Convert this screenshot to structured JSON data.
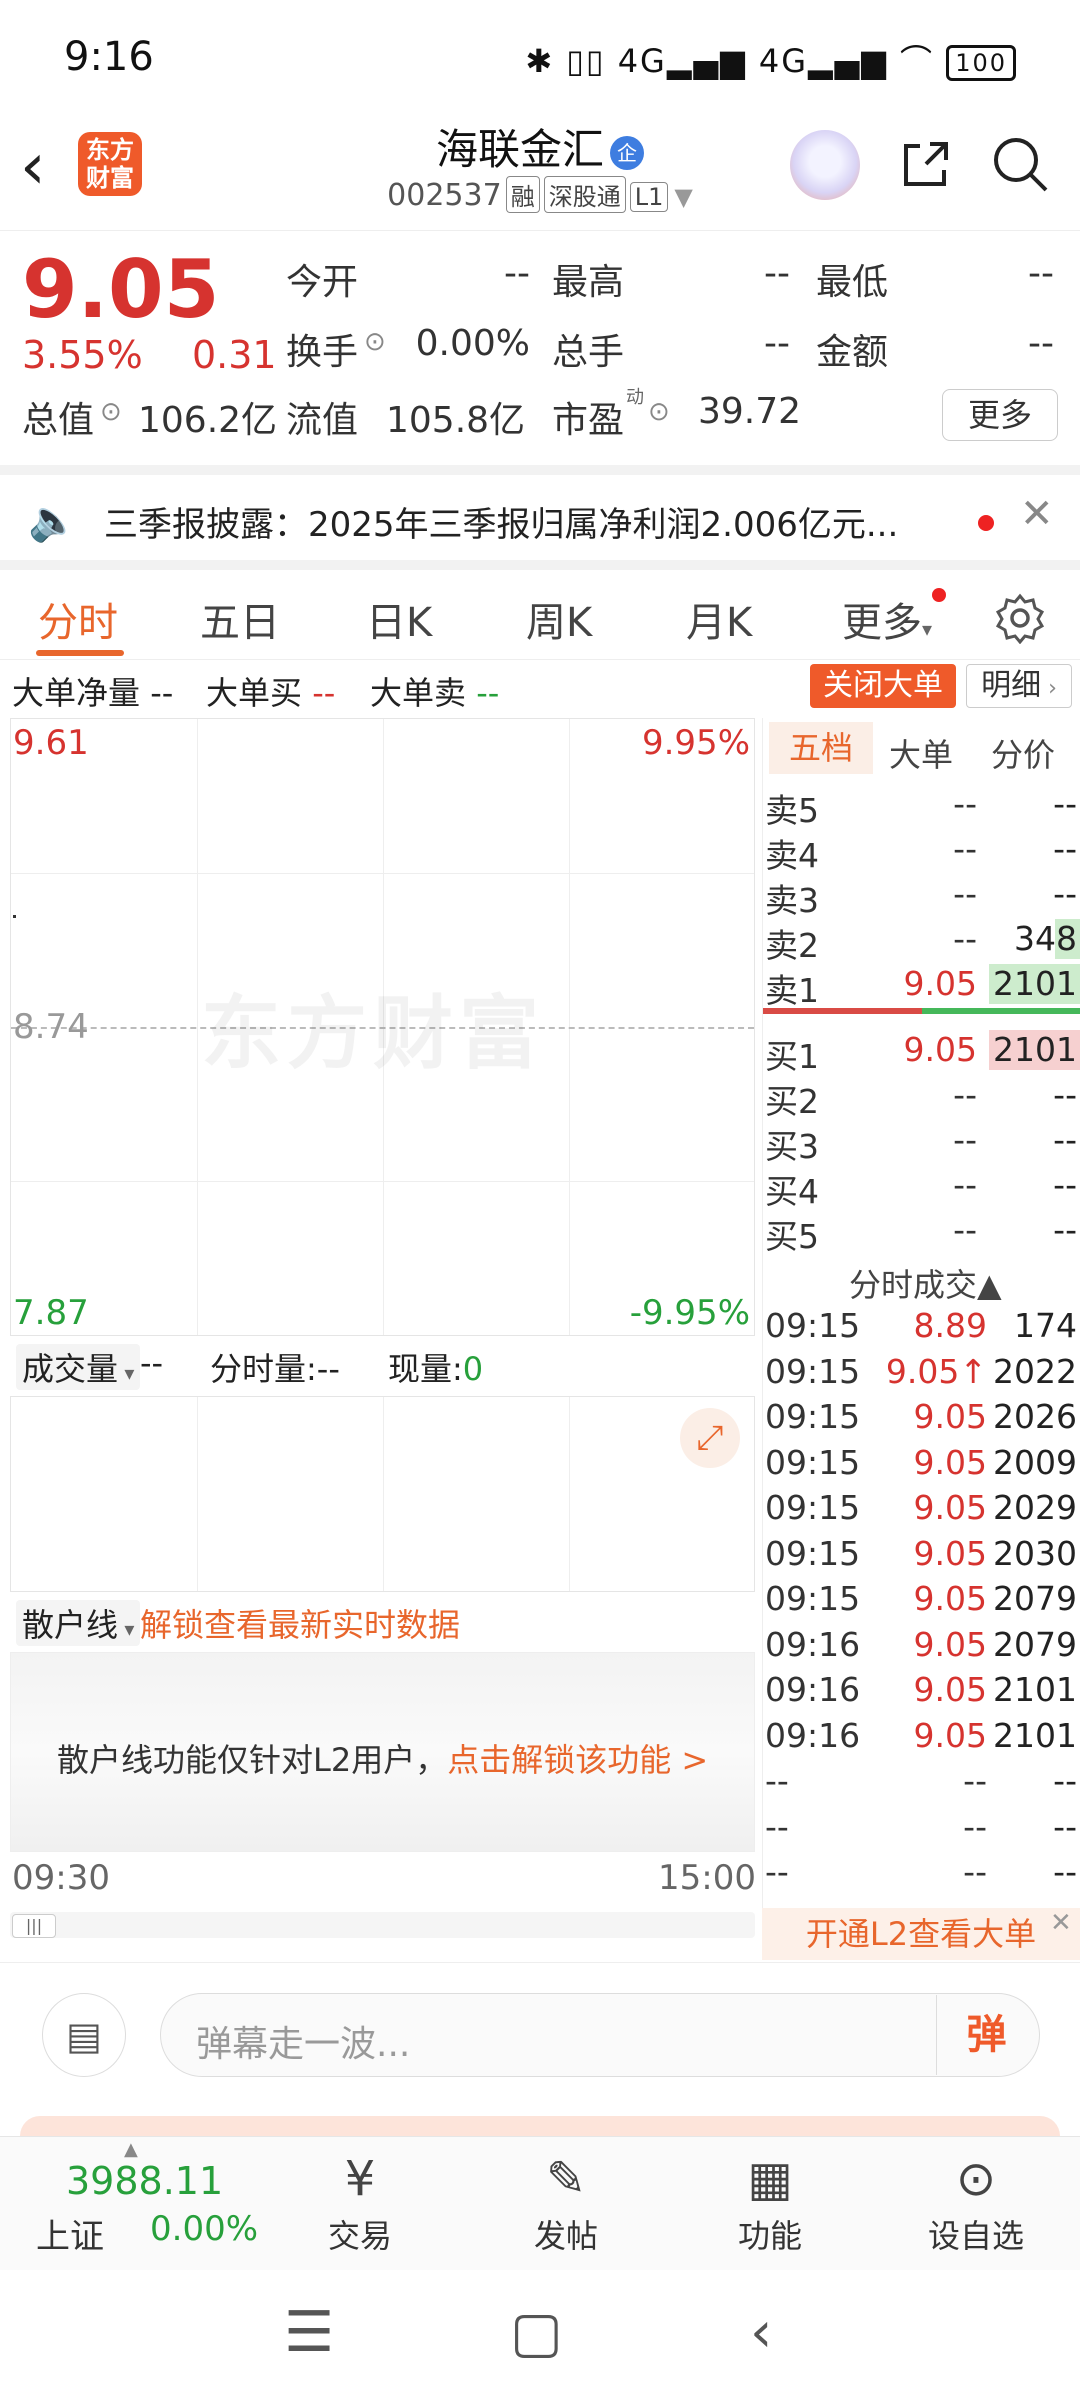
{
  "status_bar": {
    "time": "9:16",
    "icons": "✱ ▯▯ 4G▂▄▆ 4G▂▄▆ ⌒",
    "battery": "100"
  },
  "header": {
    "logo_text": "东方财富",
    "stock_name": "海联金汇",
    "badge": "企",
    "code": "002537",
    "tags": [
      "融",
      "深股通",
      "L1"
    ]
  },
  "quote": {
    "price": "9.05",
    "pct": "3.55%",
    "change": "0.31",
    "fields": [
      {
        "label": "今开",
        "value": "--"
      },
      {
        "label": "最高",
        "value": "--"
      },
      {
        "label": "最低",
        "value": "--"
      },
      {
        "label": "换手",
        "value": "0.00%"
      },
      {
        "label": "总手",
        "value": "--"
      },
      {
        "label": "金额",
        "value": "--"
      },
      {
        "label": "总值",
        "value": "106.2亿"
      },
      {
        "label": "流值",
        "value": "105.8亿"
      },
      {
        "label": "市盈",
        "value": "39.72"
      }
    ],
    "pe_sup": "动",
    "more": "更多"
  },
  "notice": {
    "text": "三季报披露：2025年三季报归属净利润2.006亿元..."
  },
  "tabs": [
    "分时",
    "五日",
    "日K",
    "周K",
    "月K",
    "更多"
  ],
  "big_order": {
    "net_label": "大单净量",
    "net_value": "--",
    "buy_label": "大单买",
    "buy_value": "--",
    "sell_label": "大单卖",
    "sell_value": "--",
    "close_btn": "关闭大单",
    "detail_btn": "明细"
  },
  "chart": {
    "top_price": "9.61",
    "mid_price": "8.74",
    "bottom_price": "7.87",
    "top_pct": "9.95%",
    "bottom_pct": "-9.95%",
    "watermark": "东方财富",
    "volume_select": "成交量",
    "volume_value": "--",
    "minute_vol_label": "分时量:--",
    "current_vol_label": "现量:",
    "current_vol_value": "0",
    "retail_select": "散户线",
    "retail_unlock": "解锁查看最新实时数据",
    "retail_msg": "散户线功能仅针对L2用户，",
    "retail_link": "点击解锁该功能 >",
    "time_start": "09:30",
    "time_end": "15:00"
  },
  "order_book": {
    "tabs": [
      "五档",
      "大单",
      "分价"
    ],
    "asks": [
      {
        "label": "卖5",
        "price": "--",
        "vol": "--"
      },
      {
        "label": "卖4",
        "price": "--",
        "vol": "--"
      },
      {
        "label": "卖3",
        "price": "--",
        "vol": "--"
      },
      {
        "label": "卖2",
        "price": "--",
        "vol": "348"
      },
      {
        "label": "卖1",
        "price": "9.05",
        "vol": "2101"
      }
    ],
    "bids": [
      {
        "label": "买1",
        "price": "9.05",
        "vol": "2101"
      },
      {
        "label": "买2",
        "price": "--",
        "vol": "--"
      },
      {
        "label": "买3",
        "price": "--",
        "vol": "--"
      },
      {
        "label": "买4",
        "price": "--",
        "vol": "--"
      },
      {
        "label": "买5",
        "price": "--",
        "vol": "--"
      }
    ],
    "ticks_title": "分时成交▲",
    "ticks": [
      {
        "time": "09:15",
        "price": "8.89",
        "vol": "174"
      },
      {
        "time": "09:15",
        "price": "9.05↑",
        "vol": "2022"
      },
      {
        "time": "09:15",
        "price": "9.05",
        "vol": "2026"
      },
      {
        "time": "09:15",
        "price": "9.05",
        "vol": "2009"
      },
      {
        "time": "09:15",
        "price": "9.05",
        "vol": "2029"
      },
      {
        "time": "09:15",
        "price": "9.05",
        "vol": "2030"
      },
      {
        "time": "09:15",
        "price": "9.05",
        "vol": "2079"
      },
      {
        "time": "09:16",
        "price": "9.05",
        "vol": "2079"
      },
      {
        "time": "09:16",
        "price": "9.05",
        "vol": "2101"
      },
      {
        "time": "09:16",
        "price": "9.05",
        "vol": "2101"
      },
      {
        "time": "--",
        "price": "--",
        "vol": "--"
      },
      {
        "time": "--",
        "price": "--",
        "vol": "--"
      },
      {
        "time": "--",
        "price": "--",
        "vol": "--"
      }
    ],
    "l2_banner": "开通L2查看大单"
  },
  "danmu": {
    "placeholder": "弹幕走一波...",
    "button": "弹"
  },
  "bottom_nav": {
    "index_value": "3988.11",
    "index_name": "上证",
    "index_pct": "0.00%",
    "items": [
      {
        "label": "交易",
        "icon": "yen-icon"
      },
      {
        "label": "发帖",
        "icon": "edit-icon"
      },
      {
        "label": "功能",
        "icon": "grid-icon"
      },
      {
        "label": "设自选",
        "icon": "more-icon"
      }
    ]
  },
  "colors": {
    "up": "#d6332f",
    "down": "#27a03b",
    "accent": "#e8662c"
  }
}
